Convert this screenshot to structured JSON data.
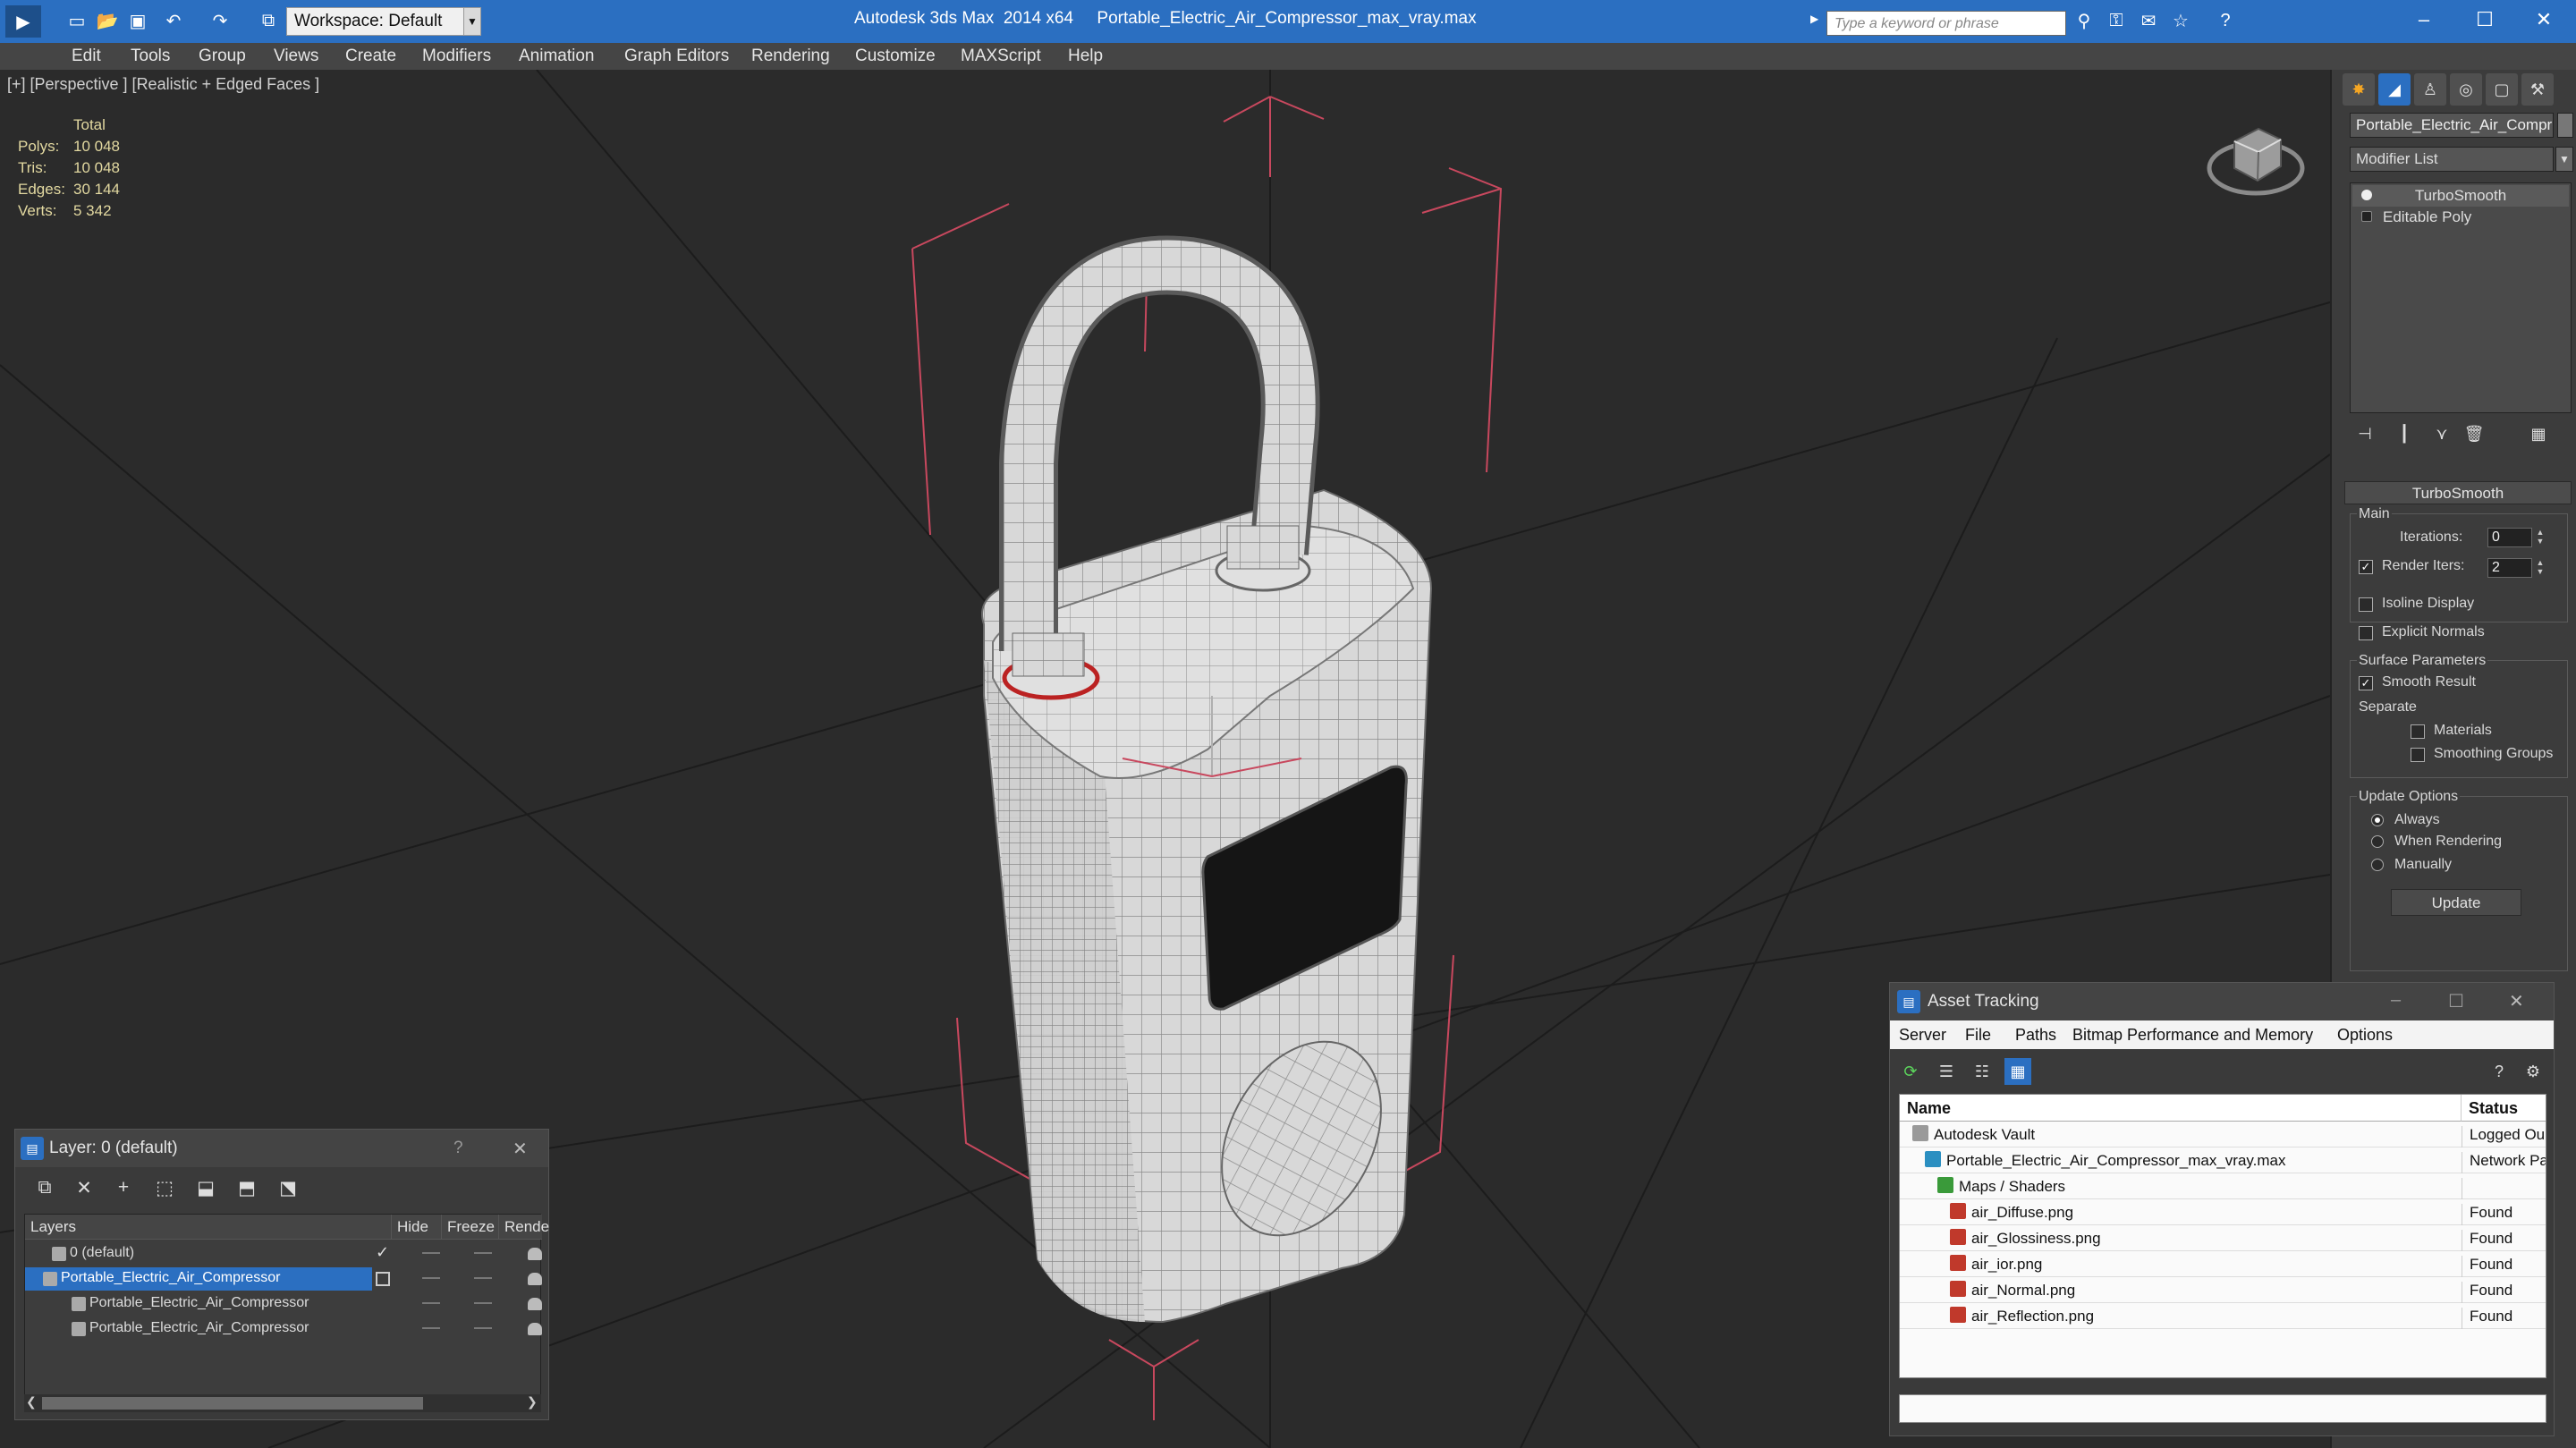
{
  "titlebar": {
    "workspace": "Workspace: Default",
    "app_title": "Autodesk 3ds Max  2014 x64     Portable_Electric_Air_Compressor_max_vray.max",
    "search_placeholder": "Type a keyword or phrase",
    "accent_color": "#2b6fc1"
  },
  "menu": [
    "Edit",
    "Tools",
    "Group",
    "Views",
    "Create",
    "Modifiers",
    "Animation",
    "Graph Editors",
    "Rendering",
    "Customize",
    "MAXScript",
    "Help"
  ],
  "viewport": {
    "label": "[+] [Perspective ] [Realistic + Edged Faces ]",
    "stats": {
      "header": "Total",
      "rows": [
        {
          "label": "Polys:",
          "value": "10 048"
        },
        {
          "label": "Tris:",
          "value": "10 048"
        },
        {
          "label": "Edges:",
          "value": "30 144"
        },
        {
          "label": "Verts:",
          "value": "5 342"
        }
      ]
    }
  },
  "command_panel": {
    "object_name": "Portable_Electric_Air_Compre",
    "modifier_list": "Modifier List",
    "stack": [
      "TurboSmooth",
      "Editable Poly"
    ],
    "rollout": {
      "title": "TurboSmooth",
      "main_label": "Main",
      "iterations_label": "Iterations:",
      "iterations_value": "0",
      "render_iters_label": "Render Iters:",
      "render_iters_value": "2",
      "isoline_label": "Isoline Display",
      "explicit_normals_label": "Explicit Normals",
      "surface_label": "Surface Parameters",
      "smooth_result_label": "Smooth Result",
      "separate_label": "Separate",
      "materials_label": "Materials",
      "smoothing_groups_label": "Smoothing Groups",
      "update_options_label": "Update Options",
      "always_label": "Always",
      "when_rendering_label": "When Rendering",
      "manually_label": "Manually",
      "update_button": "Update"
    }
  },
  "layer_window": {
    "title": "Layer: 0 (default)",
    "help": "?",
    "close": "✕",
    "columns": [
      "Layers",
      "Hide",
      "Freeze",
      "Rende"
    ],
    "rows": [
      {
        "name": "0 (default)",
        "selected": false
      },
      {
        "name": "Portable_Electric_Air_Compressor",
        "selected": true
      },
      {
        "name": "Portable_Electric_Air_Compressor",
        "selected": false
      },
      {
        "name": "Portable_Electric_Air_Compressor",
        "selected": false
      }
    ]
  },
  "asset_window": {
    "title": "Asset Tracking",
    "menu": [
      "Server",
      "File",
      "Paths",
      "Bitmap Performance and Memory",
      "Options"
    ],
    "columns": [
      "Name",
      "Status"
    ],
    "rows": [
      {
        "name": "Autodesk Vault",
        "status": "Logged Ou",
        "indent": 1,
        "icon_color": "#9a9a9a"
      },
      {
        "name": "Portable_Electric_Air_Compressor_max_vray.max",
        "status": "Network Pa",
        "indent": 2,
        "icon_color": "#2b8fc1"
      },
      {
        "name": "Maps / Shaders",
        "status": "",
        "indent": 3,
        "icon_color": "#3a9a3a"
      },
      {
        "name": "air_Diffuse.png",
        "status": "Found",
        "indent": 4,
        "icon_color": "#c0392b"
      },
      {
        "name": "air_Glossiness.png",
        "status": "Found",
        "indent": 4,
        "icon_color": "#c0392b"
      },
      {
        "name": "air_ior.png",
        "status": "Found",
        "indent": 4,
        "icon_color": "#c0392b"
      },
      {
        "name": "air_Normal.png",
        "status": "Found",
        "indent": 4,
        "icon_color": "#c0392b"
      },
      {
        "name": "air_Reflection.png",
        "status": "Found",
        "indent": 4,
        "icon_color": "#c0392b"
      }
    ]
  }
}
